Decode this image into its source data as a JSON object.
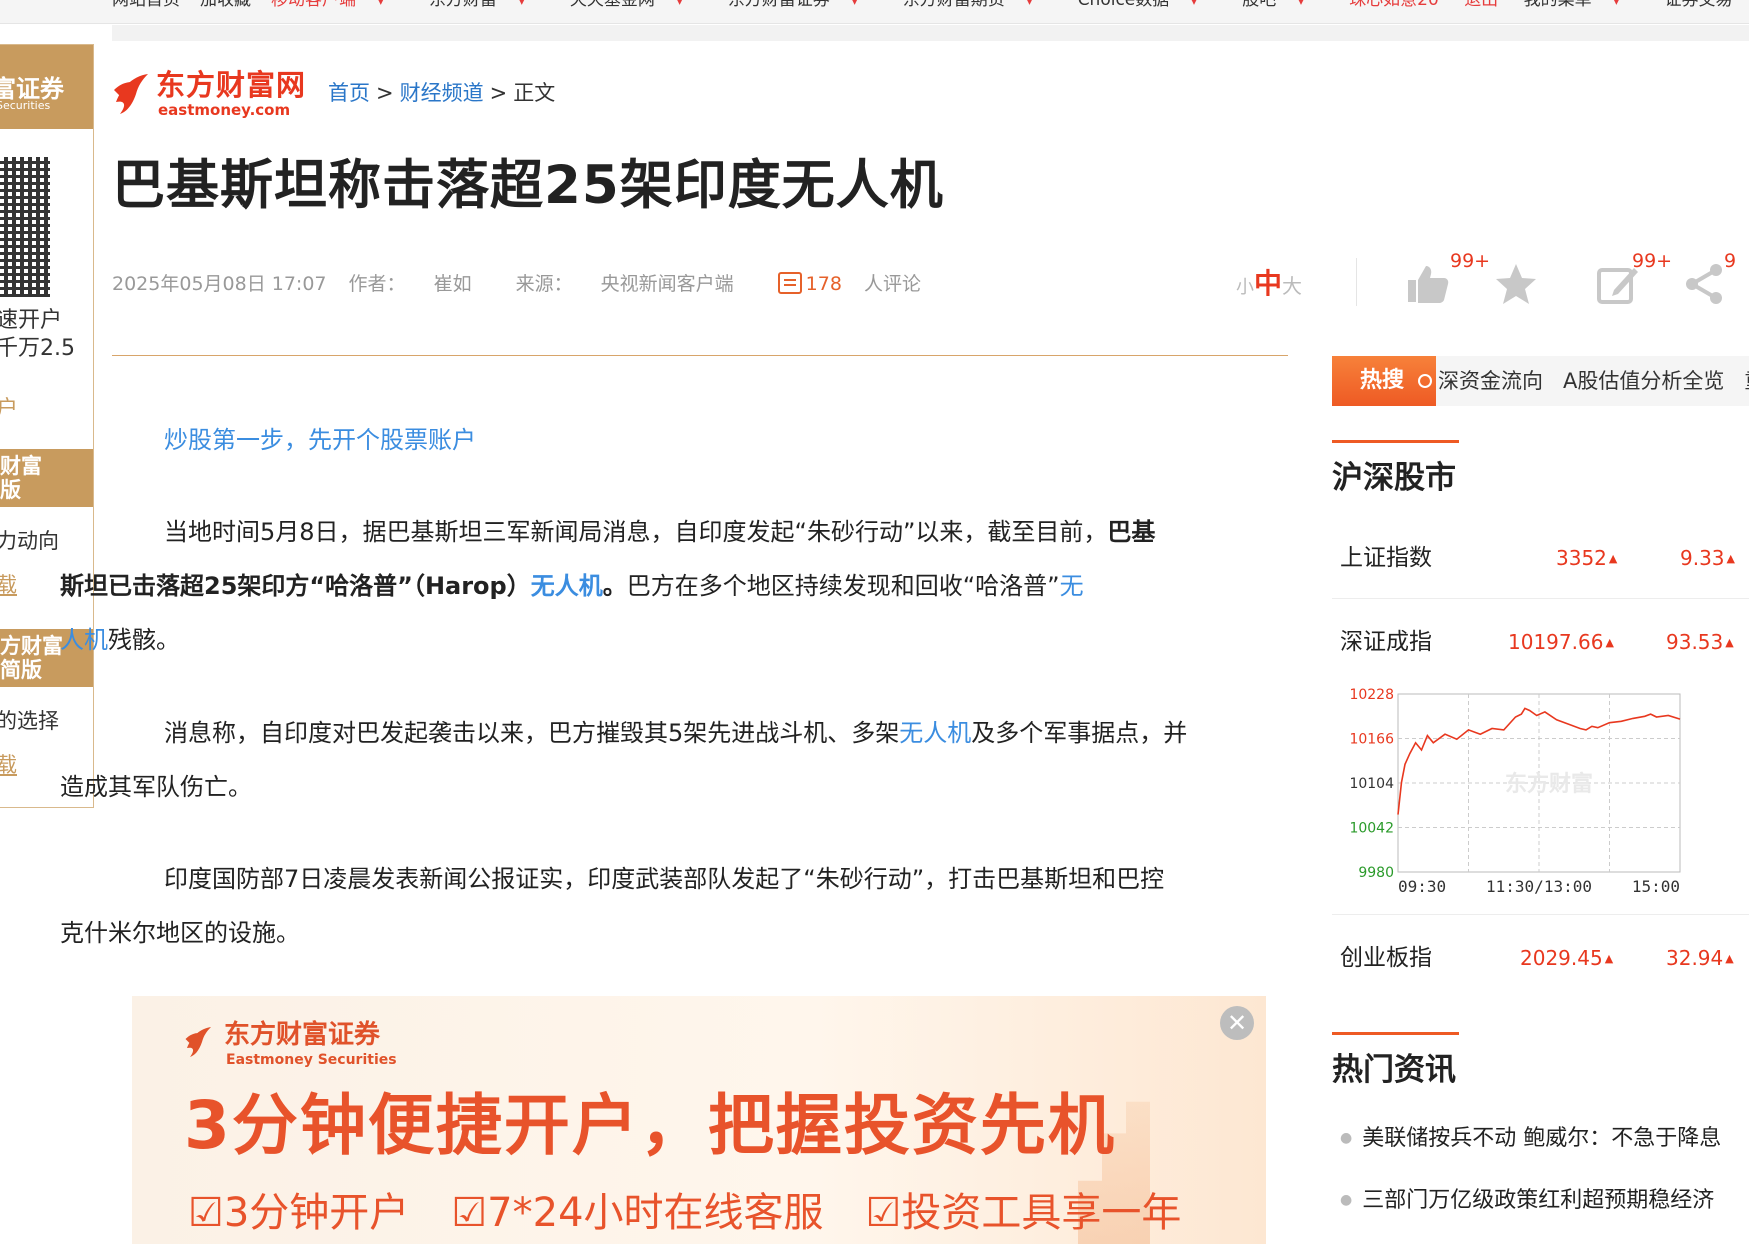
{
  "topnav": {
    "items": [
      "网站首页",
      "加收藏",
      "移动客户端",
      "东方财富",
      "天天基金网",
      "东方财富证券",
      "东方财富期货",
      "Choice数据",
      "股吧",
      "珠心如意20",
      "退出",
      "我的菜单",
      "证券交易"
    ]
  },
  "left_ad": {
    "brand": "富证券",
    "brand_en": "Securities",
    "line1": "速开户",
    "line2": "千万2.5",
    "cta1": "户",
    "band1": "财富\n版",
    "link1": "力动向",
    "cta2": "载",
    "band2": "方财富\n简版",
    "link2": "的选择",
    "cta3": "载"
  },
  "header": {
    "logo_cn": "东方财富网",
    "logo_en": "eastmoney.com",
    "breadcrumb": {
      "home": "首页",
      "sep": ">",
      "channel": "财经频道",
      "current": "正文"
    }
  },
  "article": {
    "title": "巴基斯坦称击落超25架印度无人机",
    "date": "2025年05月08日 17:07",
    "author_label": "作者：",
    "author": "崔如",
    "source_label": "来源：",
    "source": "央视新闻客户端",
    "comment_count": "178",
    "comment_unit": "人评论",
    "lead_link": "炒股第一步，先开个股票账户",
    "p1": {
      "a": "当地时间5月8日，据巴基斯坦三军新闻局消息，自印度发起“朱砂行动”以来，截至目前，",
      "b": "巴基",
      "c": "斯坦已击落超25架印方“哈洛普”（Harop）",
      "kw1": "无人机",
      "d": "。",
      "e": "巴方在多个地区持续发现和回收“哈洛普”",
      "kw2a": "无",
      "kw2b": "人机",
      "f": "残骸。"
    },
    "p2": {
      "a": "消息称，自印度对巴发起袭击以来，巴方摧毁其5架先进战斗机、多架",
      "kw": "无人机",
      "b": "及多个军事据点，并",
      "c": "造成其军队伤亡。"
    },
    "p3": {
      "a": "印度国防部7日凌晨发表新闻公报证实，印度武装部队发起了“朱砂行动”，打击巴基斯坦和巴控",
      "b": "克什米尔地区的设施。"
    }
  },
  "fontsize": {
    "small": "小",
    "medium": "中",
    "large": "大"
  },
  "tools": {
    "like_count": "99+",
    "comment_count": "99+",
    "share_count": "9"
  },
  "banner": {
    "logo_cn": "东方财富证券",
    "logo_en": "Eastmoney Securities",
    "headline": "3分钟便捷开户，把握投资先机",
    "features": [
      "☑3分钟开户",
      "☑7*24小时在线客服",
      "☑投资工具享一年"
    ]
  },
  "sidebar": {
    "hot_search_label": "热搜",
    "hot_search_items": [
      "深资金流向",
      "A股估值分析全览",
      "重"
    ],
    "market_title": "沪深股市",
    "indices": [
      {
        "name": "上证指数",
        "value": "3352",
        "change": "9.33"
      },
      {
        "name": "深证成指",
        "value": "10197.66",
        "change": "93.53"
      },
      {
        "name": "创业板指",
        "value": "2029.45",
        "change": "32.94"
      }
    ],
    "news_title": "热门资讯",
    "news": [
      "美联储按兵不动 鲍威尔：不急于降息",
      "三部门万亿级政策红利超预期稳经济"
    ]
  },
  "chart_data": {
    "type": "line",
    "title": "",
    "series_name": "深证成指",
    "y_ticks": [
      10228,
      10166,
      10104,
      10042,
      9980
    ],
    "ylim": [
      9980,
      10228
    ],
    "x_ticks": [
      "09:30",
      "11:30/13:00",
      "15:00"
    ],
    "watermark": "东方财富",
    "grid": true,
    "x": [
      0,
      3,
      6,
      10,
      15,
      20,
      25,
      30,
      40,
      50,
      60,
      70,
      80,
      90,
      100,
      105,
      108,
      112,
      118,
      125,
      135,
      145,
      155,
      160,
      165,
      170,
      180,
      190,
      200,
      210,
      215,
      220,
      230,
      240
    ],
    "values": [
      10060,
      10105,
      10130,
      10145,
      10160,
      10150,
      10170,
      10160,
      10172,
      10165,
      10178,
      10172,
      10180,
      10178,
      10196,
      10200,
      10208,
      10205,
      10198,
      10203,
      10192,
      10186,
      10180,
      10178,
      10183,
      10181,
      10188,
      10190,
      10194,
      10197,
      10200,
      10196,
      10198,
      10193
    ]
  },
  "colors": {
    "brand_red": "#e8381f",
    "link_blue": "#3b8de0",
    "accent_orange": "#ee5a24",
    "ad_gold": "#c89b5e"
  },
  "icons": {
    "comment": "comment-icon",
    "like": "thumbs-up-icon",
    "favorite": "star-icon",
    "write": "edit-icon",
    "share": "share-icon",
    "close": "close-icon"
  }
}
